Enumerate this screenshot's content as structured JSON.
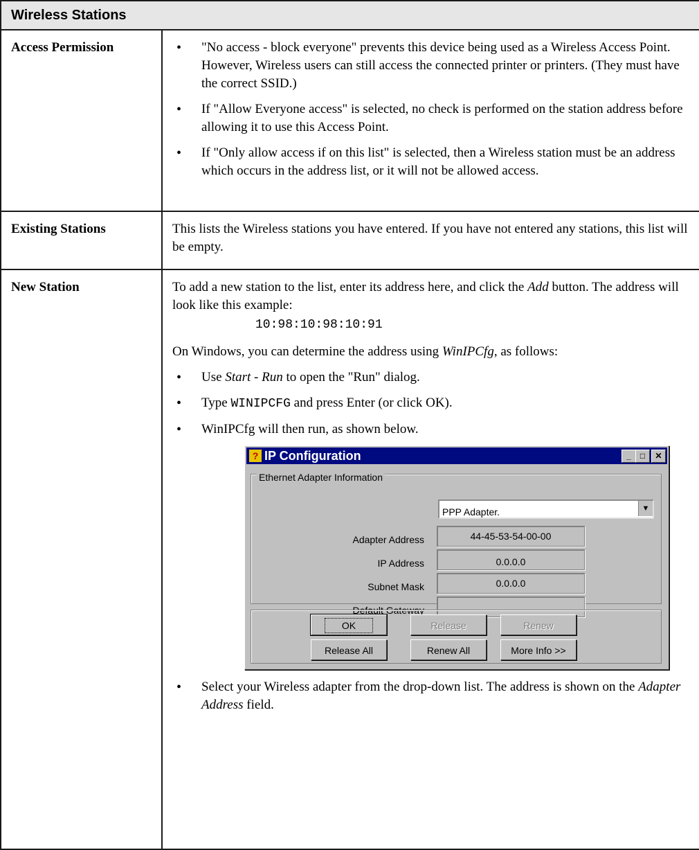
{
  "header": {
    "title": "Wireless Stations"
  },
  "rows": [
    {
      "label": "Access Permission",
      "bullets": [
        "\"No access - block everyone\" prevents this device being used as a Wireless Access Point.",
        "However, Wireless users can still access the connected printer or printers. (They must have the correct SSID.)",
        "If \"Allow Everyone access\" is selected, no check is performed on the station address before allowing it to use this Access Point.",
        "If \"Only allow access if on this list\" is selected, then a Wireless station must be an address which occurs in the address list, or it will not be allowed access."
      ]
    },
    {
      "label": "Existing Stations",
      "text": "This lists the Wireless stations you have entered. If you have not entered any stations, this list will be empty."
    },
    {
      "label": "New Station",
      "intro_a": "To add a new station to the list, enter its address here, and click the",
      "intro_em": "Add",
      "intro_b": "button. The address will look like this example:",
      "example_address": "10:98:10:98:10:91",
      "windows_a": "On Windows, you can determine the address using",
      "windows_em": "WinIPCfg",
      "windows_b": ", as follows:",
      "step1_a": "Use",
      "step1_em": "Start - Run",
      "step1_b": "to open the \"Run\" dialog.",
      "step2_a": "Type",
      "step2_code": "WINIPCFG",
      "step2_b": "and press Enter (or click OK).",
      "step3": "WinIPCfg will then run, as shown below.",
      "final_a": "Select your Wireless adapter from the drop-down list. The address is shown on the",
      "final_em": "Adapter Address",
      "final_b": "field."
    }
  ],
  "dialog": {
    "title": "IP Configuration",
    "icon": "ip-config-app-icon",
    "controls": {
      "minimize": "_",
      "maximize": "□",
      "close": "✕"
    },
    "group_label": "Ethernet  Adapter Information",
    "adapter_select": "PPP Adapter.",
    "fields": [
      {
        "label": "Adapter Address",
        "value": "44-45-53-54-00-00"
      },
      {
        "label": "IP Address",
        "value": "0.0.0.0"
      },
      {
        "label": "Subnet Mask",
        "value": "0.0.0.0"
      },
      {
        "label": "Default Gateway",
        "value": ""
      }
    ],
    "buttons": {
      "ok": "OK",
      "release": "Release",
      "renew": "Renew",
      "release_all": "Release All",
      "renew_all": "Renew All",
      "more_info": "More Info >>"
    }
  }
}
